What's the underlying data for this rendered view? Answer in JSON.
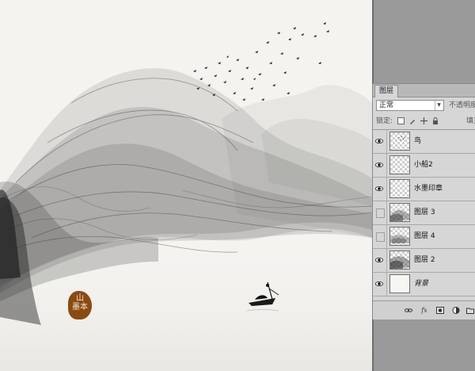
{
  "panel": {
    "tab_label": "图层",
    "blend_mode": "正常",
    "opacity_label": "不透明度",
    "lock_label": "锁定:",
    "fill_label": "填充"
  },
  "layers": [
    {
      "name": "鸟",
      "visible": true,
      "thumb": "birds"
    },
    {
      "name": "小船2",
      "visible": true,
      "thumb": "transparent"
    },
    {
      "name": "水墨印章",
      "visible": true,
      "thumb": "transparent"
    },
    {
      "name": "图层 3",
      "visible": false,
      "thumb": "ink"
    },
    {
      "name": "图层 4",
      "visible": false,
      "thumb": "ink"
    },
    {
      "name": "图层 2",
      "visible": true,
      "thumb": "ink"
    },
    {
      "name": "背景",
      "visible": true,
      "thumb": "solid"
    }
  ],
  "seal": {
    "text_line1": "山",
    "text_line2": "墨本",
    "color": "#8a4a12"
  },
  "colors": {
    "canvas": "#f4f3f0",
    "panel": "#d6d6d6",
    "workspace": "#9a9a9a"
  },
  "icons": {
    "eye": "eye-icon",
    "link": "link-layers-icon",
    "fx": "layer-style-icon",
    "mask": "layer-mask-icon",
    "adjust": "adjustment-layer-icon",
    "folder": "new-group-icon"
  }
}
